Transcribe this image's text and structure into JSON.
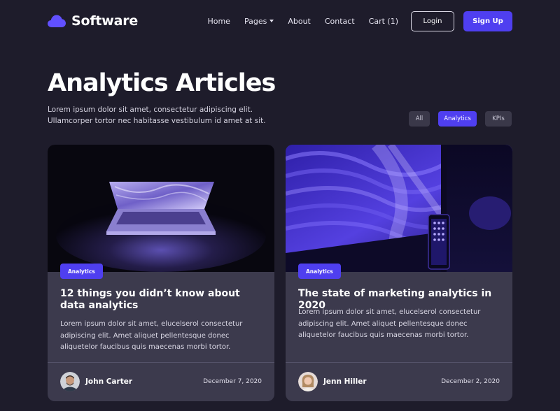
{
  "header": {
    "brand": "Software",
    "nav": [
      {
        "label": "Home"
      },
      {
        "label": "Pages"
      },
      {
        "label": "About"
      },
      {
        "label": "Contact"
      },
      {
        "label": "Cart (1)"
      }
    ],
    "login_label": "Login",
    "signup_label": "Sign Up"
  },
  "hero": {
    "title": "Analytics Articles",
    "description": "Lorem ipsum dolor sit amet, consectetur adipiscing elit. Ullamcorper tortor nec habitasse vestibulum id amet at sit."
  },
  "filters": [
    {
      "label": "All",
      "active": false
    },
    {
      "label": "Analytics",
      "active": true
    },
    {
      "label": "KPIs",
      "active": false
    }
  ],
  "articles": [
    {
      "category": "Analytics",
      "title": "12 things you didn’t know about data analytics",
      "excerpt": "Lorem ipsum dolor sit amet, elucelserol consectetur adipiscing elit. Amet aliquet pellentesque donec aliquetelor faucibus quis maecenas morbi tortor.",
      "author": "John Carter",
      "date": "December 7, 2020"
    },
    {
      "category": "Analytics",
      "title": "The state of marketing analytics in 2020",
      "excerpt": "Lorem ipsum dolor sit amet, elucelserol consectetur adipiscing elit. Amet aliquet pellentesque donec aliquetelor faucibus quis maecenas morbi tortor.",
      "author": "Jenn Hiller",
      "date": "December 2, 2020"
    }
  ],
  "colors": {
    "background": "#1e1c2b",
    "accent": "#4f3ff0",
    "card": "#3c3a4d"
  }
}
